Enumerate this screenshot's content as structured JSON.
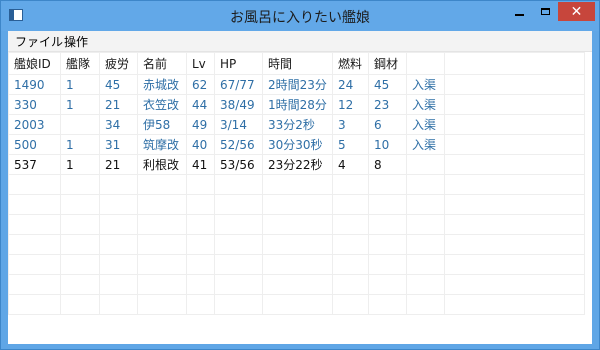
{
  "window": {
    "title": "お風呂に入りたい艦娘"
  },
  "menu": [
    "ファイル",
    "操作"
  ],
  "columns": [
    "艦娘ID",
    "艦隊",
    "疲労",
    "名前",
    "Lv",
    "HP",
    "時間",
    "燃料",
    "鋼材",
    ""
  ],
  "rows": [
    [
      "1490",
      "1",
      "45",
      "赤城改",
      "62",
      "67/77",
      "2時間23分",
      "24",
      "45",
      "入渠"
    ],
    [
      "330",
      "1",
      "21",
      "衣笠改",
      "44",
      "38/49",
      "1時間28分",
      "12",
      "23",
      "入渠"
    ],
    [
      "2003",
      "",
      "34",
      "伊58",
      "49",
      "3/14",
      "33分2秒",
      "3",
      "6",
      "入渠"
    ],
    [
      "500",
      "1",
      "31",
      "筑摩改",
      "40",
      "52/56",
      "30分30秒",
      "5",
      "10",
      "入渠"
    ],
    [
      "537",
      "1",
      "21",
      "利根改",
      "41",
      "53/56",
      "23分22秒",
      "4",
      "8",
      ""
    ]
  ],
  "colors": {
    "titlebar": "#62a8e8",
    "row_link_text": "#2f6fa6",
    "close_button": "#c7463c"
  }
}
